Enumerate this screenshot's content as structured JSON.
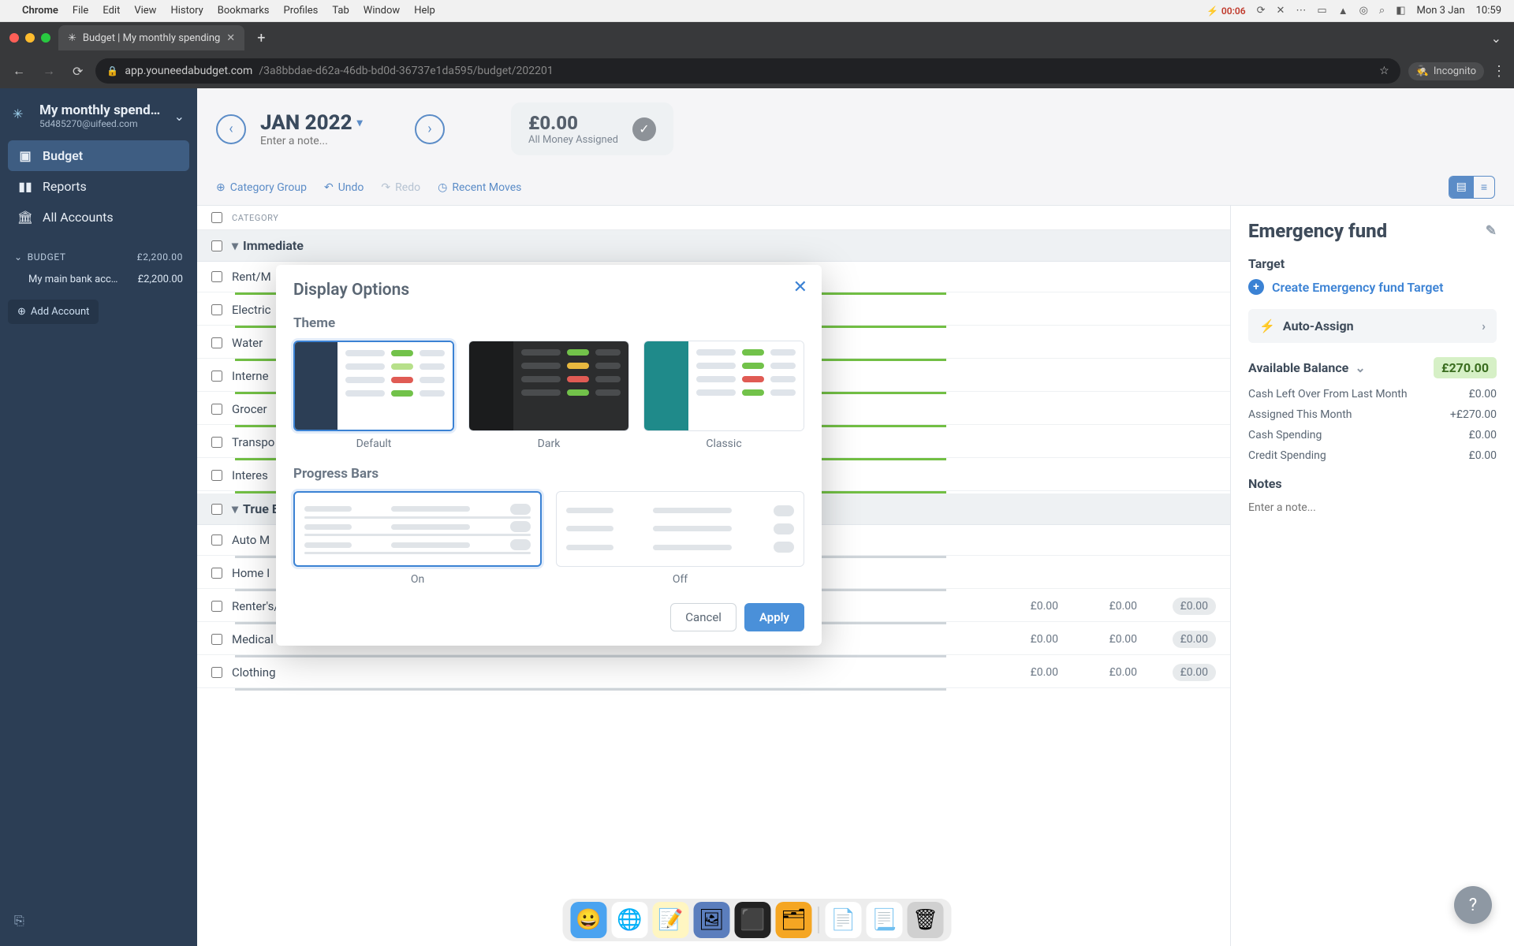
{
  "mac_menu": {
    "app": "Chrome",
    "items": [
      "File",
      "Edit",
      "View",
      "History",
      "Bookmarks",
      "Profiles",
      "Tab",
      "Window",
      "Help"
    ],
    "battery_time": "00:06",
    "date": "Mon 3 Jan",
    "time": "10:59"
  },
  "browser": {
    "tab_title": "Budget | My monthly spending",
    "url_host": "app.youneedabudget.com",
    "url_path": "/3a8bbdae-d62a-46db-bd0d-36737e1da595/budget/202201",
    "incognito_label": "Incognito"
  },
  "sidebar": {
    "budget_name": "My monthly spend…",
    "email": "5d485270@uifeed.com",
    "nav": [
      {
        "icon": "wallet-icon",
        "label": "Budget"
      },
      {
        "icon": "reports-icon",
        "label": "Reports"
      },
      {
        "icon": "bank-icon",
        "label": "All Accounts"
      }
    ],
    "budget_section_label": "BUDGET",
    "budget_total": "£2,200.00",
    "accounts": [
      {
        "name": "My main bank acc…",
        "balance": "£2,200.00"
      }
    ],
    "add_account_label": "Add Account"
  },
  "month_header": {
    "month": "JAN 2022",
    "note_placeholder": "Enter a note...",
    "money_amount": "£0.00",
    "money_label": "All Money Assigned"
  },
  "toolbar": {
    "category_group": "Category Group",
    "undo": "Undo",
    "redo": "Redo",
    "recent_moves": "Recent Moves"
  },
  "table": {
    "header": "CATEGORY",
    "groups": [
      {
        "name": "Immediate",
        "rows": [
          {
            "name": "Rent/M",
            "assigned": "",
            "activity": "",
            "available": ""
          },
          {
            "name": "Electric",
            "assigned": "",
            "activity": "",
            "available": ""
          },
          {
            "name": "Water",
            "assigned": "",
            "activity": "",
            "available": ""
          },
          {
            "name": "Interne",
            "assigned": "",
            "activity": "",
            "available": ""
          },
          {
            "name": "Grocer",
            "assigned": "",
            "activity": "",
            "available": ""
          },
          {
            "name": "Transpo",
            "assigned": "",
            "activity": "",
            "available": ""
          },
          {
            "name": "Interes",
            "assigned": "",
            "activity": "",
            "available": ""
          }
        ]
      },
      {
        "name": "True Ex",
        "rows": [
          {
            "name": "Auto M",
            "assigned": "",
            "activity": "",
            "available": ""
          },
          {
            "name": "Home I",
            "assigned": "",
            "activity": "",
            "available": ""
          },
          {
            "name": "Renter's/Home Insurance",
            "assigned": "£0.00",
            "activity": "£0.00",
            "available": "£0.00"
          },
          {
            "name": "Medical",
            "assigned": "£0.00",
            "activity": "£0.00",
            "available": "£0.00"
          },
          {
            "name": "Clothing",
            "assigned": "£0.00",
            "activity": "£0.00",
            "available": "£0.00"
          }
        ]
      }
    ]
  },
  "inspector": {
    "title": "Emergency fund",
    "target_label": "Target",
    "create_target": "Create Emergency fund Target",
    "auto_assign": "Auto-Assign",
    "available_label": "Available Balance",
    "available_amount": "£270.00",
    "rows": [
      {
        "label": "Cash Left Over From Last Month",
        "value": "£0.00"
      },
      {
        "label": "Assigned This Month",
        "value": "+£270.00"
      },
      {
        "label": "Cash Spending",
        "value": "£0.00"
      },
      {
        "label": "Credit Spending",
        "value": "£0.00"
      }
    ],
    "notes_label": "Notes",
    "notes_placeholder": "Enter a note..."
  },
  "modal": {
    "title": "Display Options",
    "theme_label": "Theme",
    "themes": [
      {
        "key": "default",
        "label": "Default",
        "selected": true
      },
      {
        "key": "dark",
        "label": "Dark",
        "selected": false
      },
      {
        "key": "classic",
        "label": "Classic",
        "selected": false
      }
    ],
    "progress_label": "Progress Bars",
    "progress_options": [
      {
        "label": "On",
        "selected": true
      },
      {
        "label": "Off",
        "selected": false
      }
    ],
    "cancel": "Cancel",
    "apply": "Apply"
  },
  "dock_icons": [
    "finder",
    "chrome",
    "notes",
    "preview",
    "terminal",
    "vscode",
    "textedit",
    "pages",
    "trash"
  ]
}
